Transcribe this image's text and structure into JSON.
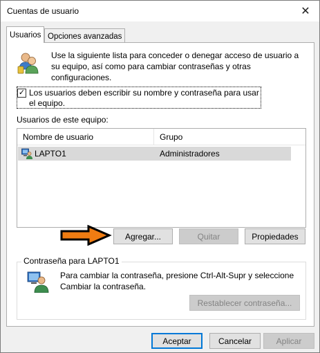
{
  "window": {
    "title": "Cuentas de usuario",
    "close_symbol": "✕"
  },
  "tabs": [
    {
      "label": "Usuarios",
      "active": true
    },
    {
      "label": "Opciones avanzadas",
      "active": false
    }
  ],
  "intro": {
    "icon": "users-icon",
    "text": "Use la siguiente lista para conceder o denegar acceso de usuario a su equipo, así como para cambiar contraseñas y otras configuraciones."
  },
  "require_login": {
    "checked": true,
    "check_symbol": "✓",
    "label": "Los usuarios deben escribir su nombre y contraseña para usar el equipo."
  },
  "users_list": {
    "label": "Usuarios de este equipo:",
    "columns": [
      "Nombre de usuario",
      "Grupo"
    ],
    "rows": [
      {
        "icon": "user-computer-icon",
        "name": "LAPTO1",
        "group": "Administradores"
      }
    ]
  },
  "list_buttons": {
    "add": "Agregar...",
    "remove": "Quitar",
    "properties": "Propiedades"
  },
  "password_group": {
    "title": "Contraseña para LAPTO1",
    "icon": "password-user-icon",
    "text": "Para cambiar la contraseña, presione Ctrl-Alt-Supr y seleccione Cambiar la contraseña.",
    "reset_button": "Restablecer contraseña..."
  },
  "dialog_buttons": {
    "ok": "Aceptar",
    "cancel": "Cancelar",
    "apply": "Aplicar"
  },
  "colors": {
    "arrow_fill": "#f07c12",
    "selection": "#d9d9d9",
    "default_border": "#0078d7"
  }
}
